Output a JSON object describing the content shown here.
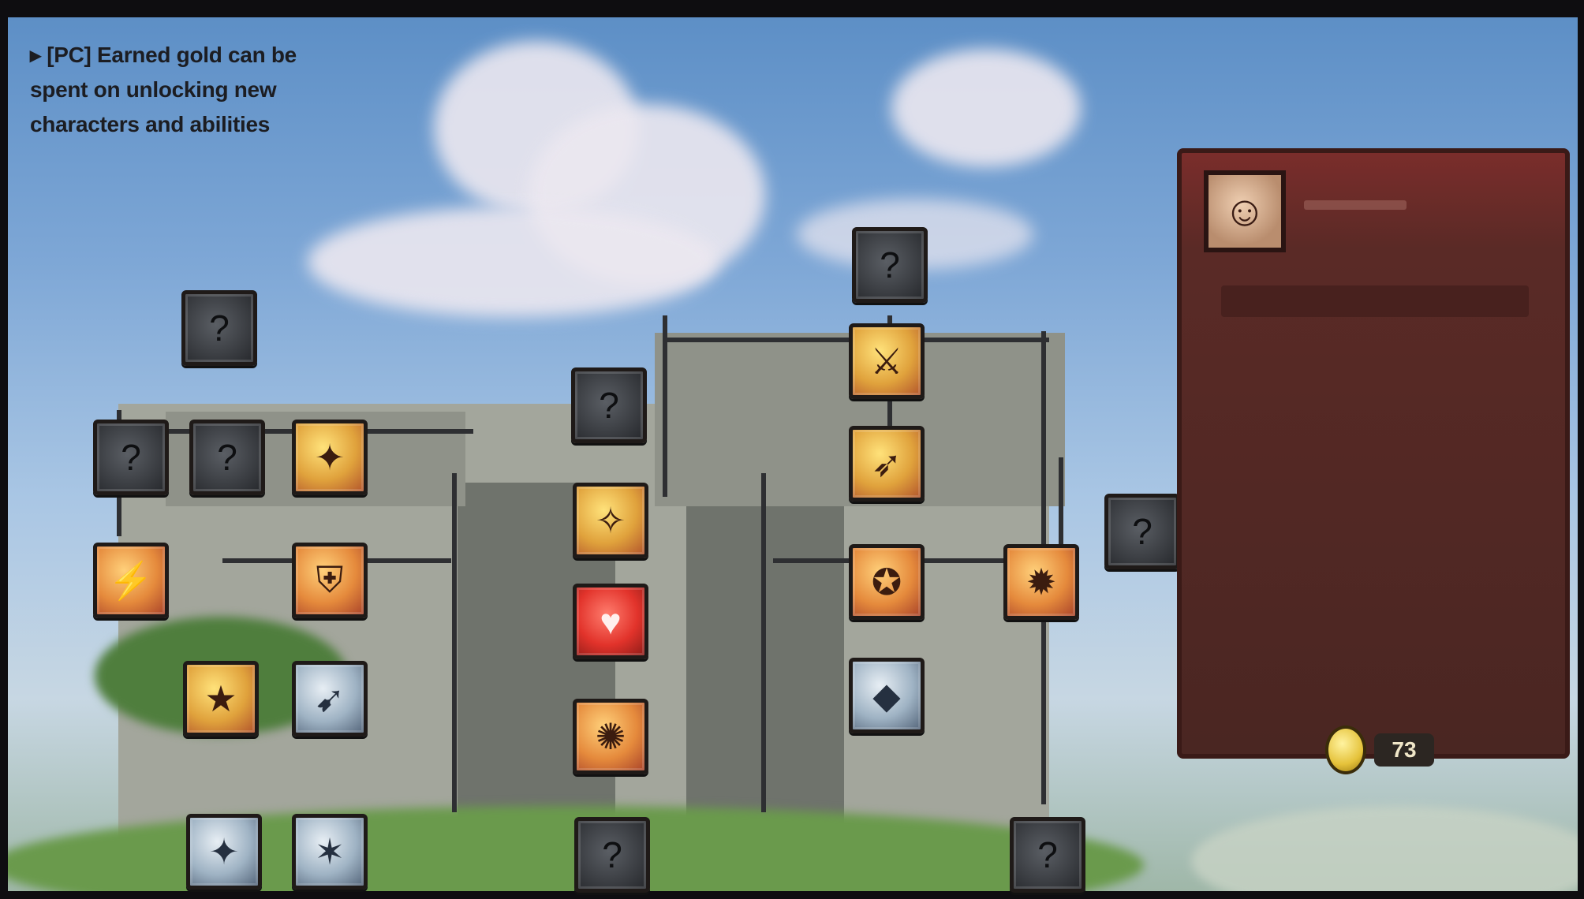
{
  "caption": "▸ [PC] Earned gold can be spent on unlocking new characters and abilities",
  "gold": {
    "count": "73"
  },
  "colors": {
    "panel": "#4a2622",
    "sky": "#7ea7d6",
    "tile_locked": "#3a3d42",
    "tile_unlocked": "#e0a23c"
  },
  "tiles": [
    {
      "state": "locked",
      "icon": "question-icon"
    },
    {
      "state": "locked",
      "icon": "question-icon"
    },
    {
      "state": "locked",
      "icon": "question-icon"
    },
    {
      "state": "locked",
      "icon": "question-icon"
    },
    {
      "state": "locked",
      "icon": "question-icon"
    },
    {
      "state": "unlocked",
      "icon": "fire-icon"
    },
    {
      "state": "unlocked",
      "icon": "sword-icon"
    },
    {
      "state": "unlocked",
      "icon": "bow-icon"
    },
    {
      "state": "unlocked",
      "icon": "bolt-icon"
    },
    {
      "state": "unlocked",
      "icon": "shield-icon"
    },
    {
      "state": "unlocked",
      "icon": "heart-icon"
    },
    {
      "state": "unlocked",
      "icon": "boot-icon"
    },
    {
      "state": "unlocked",
      "icon": "claw-icon"
    },
    {
      "state": "unlocked",
      "icon": "star-icon"
    },
    {
      "state": "unlocked",
      "icon": "flame-icon"
    },
    {
      "state": "locked",
      "icon": "feather-icon"
    },
    {
      "state": "locked",
      "icon": "spark-icon"
    },
    {
      "state": "locked",
      "icon": "gem-icon"
    },
    {
      "state": "locked",
      "icon": "question-icon"
    },
    {
      "state": "locked",
      "icon": "question-icon"
    },
    {
      "state": "locked",
      "icon": "question-icon"
    },
    {
      "state": "locked",
      "icon": "question-icon"
    },
    {
      "state": "locked",
      "icon": "question-icon"
    }
  ]
}
